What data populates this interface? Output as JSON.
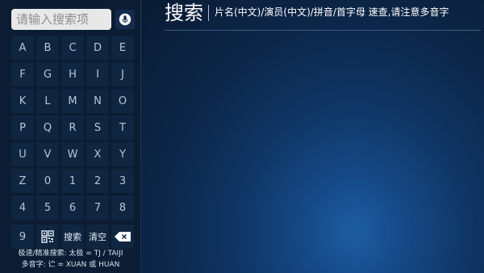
{
  "search": {
    "placeholder_text": "请输入搜索项",
    "mic_icon": "microphone-icon"
  },
  "keyboard": {
    "rows": [
      [
        "A",
        "B",
        "C",
        "D",
        "E"
      ],
      [
        "F",
        "G",
        "H",
        "I",
        "J"
      ],
      [
        "K",
        "L",
        "M",
        "N",
        "O"
      ],
      [
        "P",
        "Q",
        "R",
        "S",
        "T"
      ],
      [
        "U",
        "V",
        "W",
        "X",
        "Y"
      ],
      [
        "Z",
        "0",
        "1",
        "2",
        "3"
      ],
      [
        "4",
        "5",
        "6",
        "7",
        "8"
      ]
    ],
    "last_row": {
      "key_9": "9",
      "qr_icon": "qr-code-icon",
      "search_label": "搜索",
      "clear_label": "清空",
      "backspace_icon": "backspace-icon"
    }
  },
  "hints": {
    "line1": "极速/精准搜索: 太极 = TJ / TAIJI",
    "line2": "多音字: 𬣞 = XUAN 或 HUAN"
  },
  "header": {
    "title": "搜索",
    "subtitle": "片名(中文)/演员(中文)/拼音/首字母 速查,请注意多音字"
  }
}
